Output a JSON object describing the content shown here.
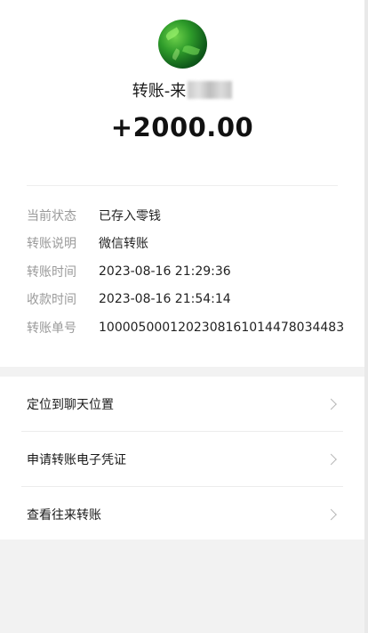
{
  "header": {
    "title_prefix": "转账-来"
  },
  "amount": "+2000.00",
  "details": [
    {
      "label": "当前状态",
      "value": "已存入零钱"
    },
    {
      "label": "转账说明",
      "value": "微信转账"
    },
    {
      "label": "转账时间",
      "value": "2023-08-16 21:29:36"
    },
    {
      "label": "收款时间",
      "value": "2023-08-16 21:54:14"
    },
    {
      "label": "转账单号",
      "value": "1000050001202308161014478034483"
    }
  ],
  "actions": [
    {
      "label": "定位到聊天位置"
    },
    {
      "label": "申请转账电子凭证"
    },
    {
      "label": "查看往来转账"
    }
  ],
  "icons": {
    "avatar": "avatar-image",
    "chevron": "chevron-right-icon"
  },
  "colors": {
    "background": "#f2f2f2",
    "card": "#ffffff",
    "label_gray": "#9a9a9a",
    "text": "#1a1a1a"
  }
}
